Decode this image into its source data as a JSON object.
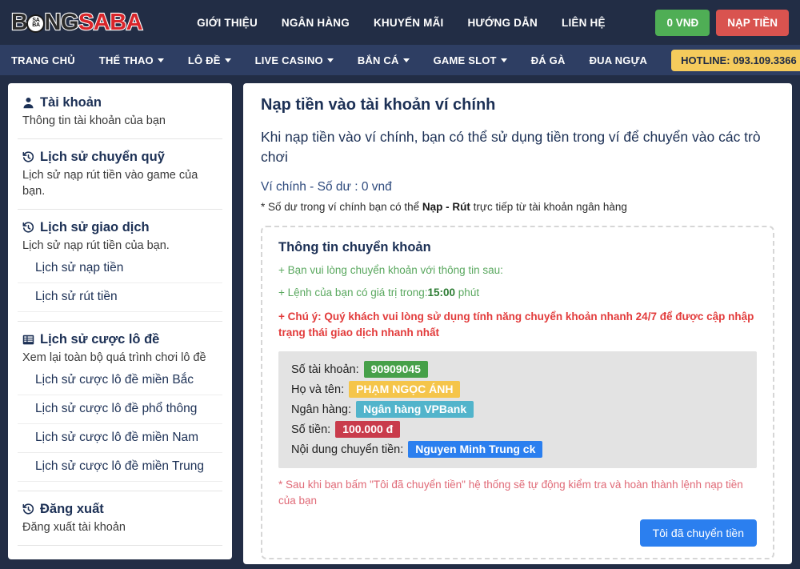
{
  "header": {
    "logo": {
      "part1": "B",
      "ball": [
        "SA",
        "BA"
      ],
      "part2": "NG",
      "part3": "SABA"
    },
    "nav": [
      {
        "label": "GIỚI THIỆU"
      },
      {
        "label": "NGÂN HÀNG"
      },
      {
        "label": "KHUYẾN MÃI"
      },
      {
        "label": "HƯỚNG DẪN"
      },
      {
        "label": "LIÊN HỆ"
      }
    ],
    "balance_button": "0 VNĐ",
    "deposit_button": "NẠP TIỀN",
    "colors": {
      "balance": "#4fae55",
      "deposit": "#d9534f",
      "bar": "#222d45"
    }
  },
  "subnav": {
    "items": [
      {
        "label": "TRANG CHỦ",
        "caret": false
      },
      {
        "label": "THỂ THAO",
        "caret": true
      },
      {
        "label": "LÔ ĐỀ",
        "caret": true
      },
      {
        "label": "LIVE CASINO",
        "caret": true
      },
      {
        "label": "BẮN CÁ",
        "caret": true
      },
      {
        "label": "GAME SLOT",
        "caret": true
      },
      {
        "label": "ĐÁ GÀ",
        "caret": false
      },
      {
        "label": "ĐUA NGỰA",
        "caret": false
      }
    ],
    "hotline": "HOTLINE: 093.109.3366",
    "colors": {
      "bar": "#2e3e63",
      "hotline": "#f5cb5c"
    }
  },
  "sidebar": {
    "groups": [
      {
        "icon": "user-icon",
        "title": "Tài khoản",
        "desc": "Thông tin tài khoản của bạn",
        "subs": []
      },
      {
        "icon": "history-icon",
        "title": "Lịch sử chuyển quỹ",
        "desc": "Lịch sử nạp rút tiền vào game của bạn.",
        "subs": []
      },
      {
        "icon": "history-icon",
        "title": "Lịch sử giao dịch",
        "desc": "Lịch sử nạp rút tiền của bạn.",
        "subs": [
          "Lịch sử nạp tiền",
          "Lịch sử rút tiền"
        ]
      },
      {
        "icon": "table-icon",
        "title": "Lịch sử cược lô đề",
        "desc": "Xem lại toàn bộ quá trình chơi lô đề",
        "subs": [
          "Lịch sử cược lô đề miền Bắc",
          "Lịch sử cược lô đề phổ thông",
          "Lịch sử cược lô đề miền Nam",
          "Lịch sử cược lô đề miền Trung"
        ]
      },
      {
        "icon": "history-icon",
        "title": "Đăng xuất",
        "desc": "Đăng xuất tài khoản",
        "subs": []
      }
    ]
  },
  "main": {
    "title": "Nạp tiền vào tài khoản ví chính",
    "lead": "Khi nạp tiền vào ví chính, bạn có thể sử dụng tiền trong ví để chuyển vào các trò chơi",
    "wallet_line": "Ví chính - Số dư : 0 vnđ",
    "note_prefix": "* Số dư trong ví chính bạn có thể ",
    "note_bold": "Nạp - Rút",
    "note_suffix": " trực tiếp từ tài khoản ngân hàng",
    "info_box": {
      "title": "Thông tin chuyển khoản",
      "line1": "+ Bạn vui lòng chuyển khoản với thông tin sau:",
      "line2_prefix": "+ Lệnh của bạn có giá trị trong:",
      "line2_bold": "15:00",
      "line2_suffix": " phút",
      "warning": "+ Chú ý: Quý khách vui lòng sử dụng tính năng chuyển khoản nhanh 24/7 để được cập nhập trạng thái giao dịch nhanh nhất",
      "details": [
        {
          "label": "Số tài khoản:",
          "value": "90909045",
          "color": "green"
        },
        {
          "label": "Họ và tên:",
          "value": "PHẠM NGỌC ÁNH",
          "color": "yellow"
        },
        {
          "label": "Ngân hàng:",
          "value": "Ngân hàng VPBank",
          "color": "teal"
        },
        {
          "label": "Số tiền:",
          "value": "100.000 đ",
          "color": "red"
        },
        {
          "label": "Nội dung chuyển tiền:",
          "value": "Nguyen Minh Trung ck",
          "color": "blue"
        }
      ],
      "bottom_note": "* Sau khi bạn bấm \"Tôi đã chuyển tiền\" hệ thống sẽ tự động kiểm tra và hoàn thành lệnh nạp tiền của bạn",
      "confirm_button": "Tôi đã chuyển tiền"
    }
  }
}
